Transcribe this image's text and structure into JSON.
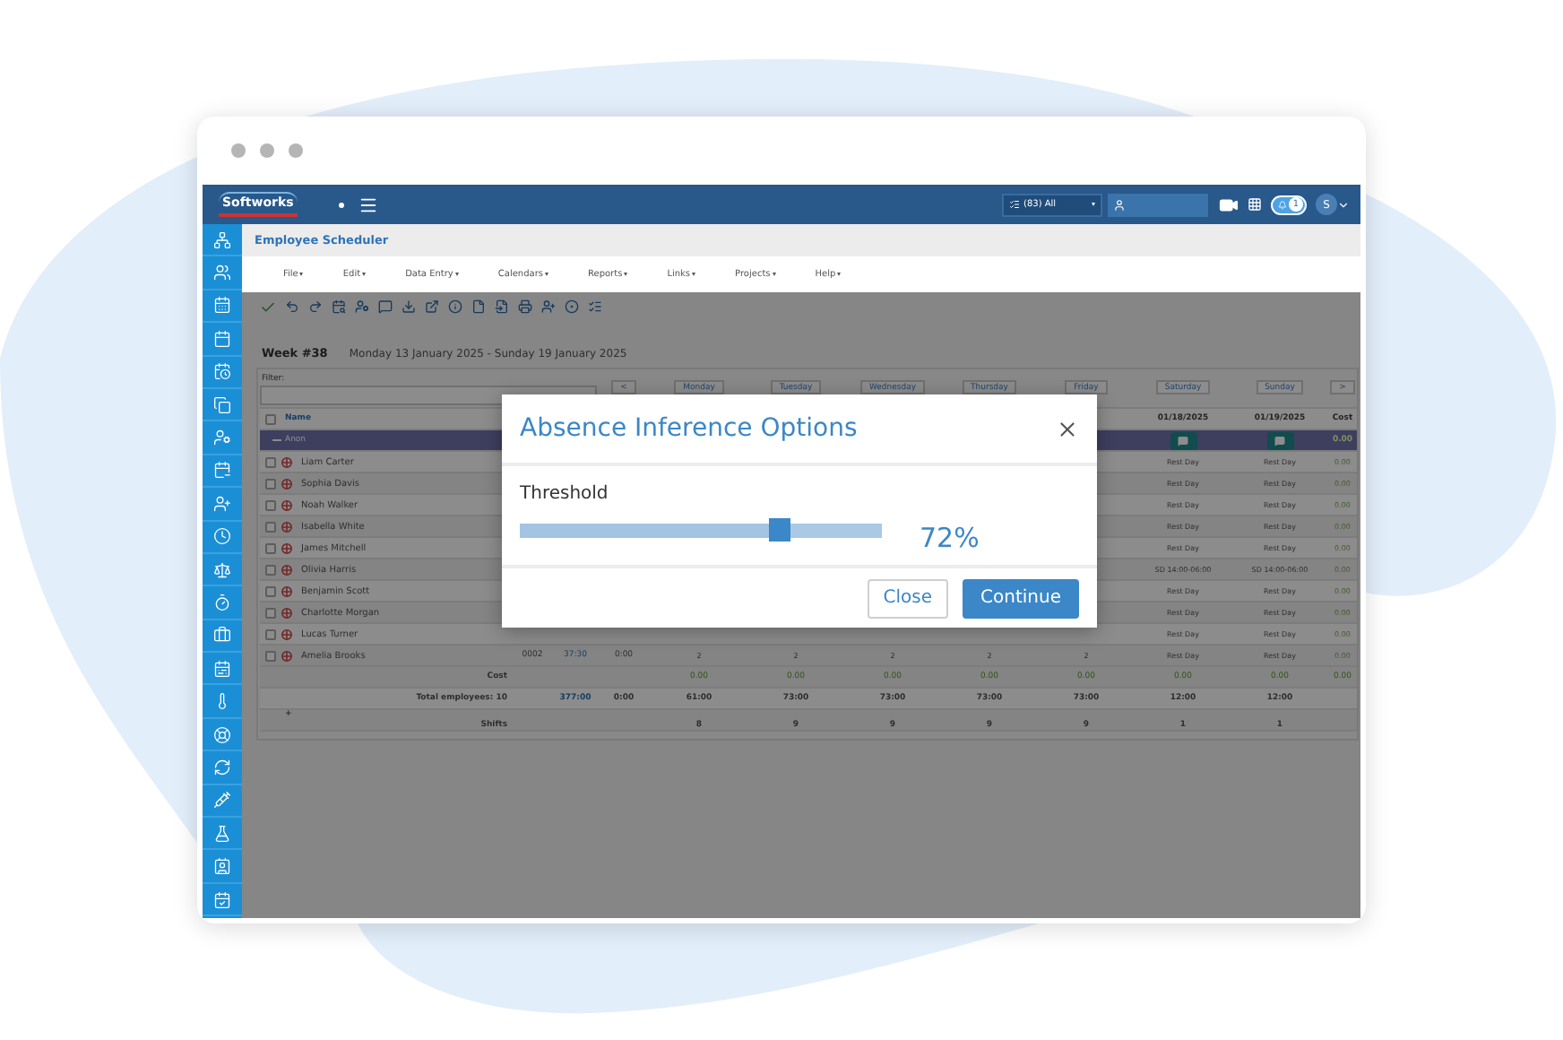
{
  "top_bar": {
    "logo": "Softworks",
    "dropdown": {
      "value": "(83) All"
    },
    "notification_count": "1",
    "avatar": "S"
  },
  "app_title": "Employee Scheduler",
  "menu": [
    "File",
    "Edit",
    "Data Entry",
    "Calendars",
    "Reports",
    "Links",
    "Projects",
    "Help"
  ],
  "week": {
    "number": "Week #38",
    "range": "Monday 13 January 2025 - Sunday 19 January 2025"
  },
  "filter": {
    "label": "Filter:"
  },
  "day_nav": {
    "prev": "<",
    "next": ">",
    "days": [
      "Monday",
      "Tuesday",
      "Wednesday",
      "Thursday",
      "Friday",
      "Saturday",
      "Sunday"
    ]
  },
  "table": {
    "header": {
      "checked": false,
      "name": "Name",
      "dates": [
        "01/18/2025",
        "01/19/2025"
      ],
      "cost": "Cost"
    },
    "group": {
      "label": "Anon",
      "expanded": true,
      "cells": [
        {
          "kind": "chat"
        },
        {
          "kind": "chat"
        }
      ],
      "cost": "0.00"
    },
    "rows": [
      {
        "name": "Liam Carter",
        "checked": false,
        "days": [
          "Rest Day",
          "Rest Day"
        ],
        "cost": "0.00"
      },
      {
        "name": "Sophia Davis",
        "checked": false,
        "days": [
          "Rest Day",
          "Rest Day"
        ],
        "cost": "0.00"
      },
      {
        "name": "Noah Walker",
        "checked": false,
        "days": [
          "Rest Day",
          "Rest Day"
        ],
        "cost": "0.00"
      },
      {
        "name": "Isabella White",
        "checked": false,
        "days": [
          "Rest Day",
          "Rest Day"
        ],
        "cost": "0.00"
      },
      {
        "name": "James Mitchell",
        "checked": false,
        "days": [
          "Rest Day",
          "Rest Day"
        ],
        "cost": "0.00"
      },
      {
        "name": "Olivia Harris",
        "checked": false,
        "days": [
          "SD 14:00-06:00",
          "SD 14:00-06:00"
        ],
        "cost": "0.00"
      },
      {
        "name": "Benjamin Scott",
        "checked": false,
        "days": [
          "Rest Day",
          "Rest Day"
        ],
        "cost": "0.00"
      },
      {
        "name": "Charlotte Morgan",
        "checked": false,
        "days": [
          "Rest Day",
          "Rest Day"
        ],
        "cost": "0.00"
      },
      {
        "name": "Lucas Turner",
        "checked": false,
        "days": [
          "Rest Day",
          "Rest Day"
        ],
        "cost": "0.00"
      },
      {
        "name": "Amelia Brooks",
        "checked": false,
        "column_3": "0002",
        "column_4": "37:30",
        "column_5": "0:00",
        "days": [
          "2",
          "2",
          "2",
          "2",
          "2",
          "Rest Day",
          "Rest Day"
        ],
        "cost": "0.00"
      }
    ],
    "cost_row": {
      "label": "Cost",
      "days": [
        "0.00",
        "0.00",
        "0.00",
        "0.00",
        "0.00",
        "0.00",
        "0.00"
      ],
      "cost": "0.00"
    },
    "total_row": {
      "label": "Total employees: 10",
      "column_4": "377:00",
      "column_5": "0:00",
      "days": [
        "61:00",
        "73:00",
        "73:00",
        "73:00",
        "73:00",
        "12:00",
        "12:00"
      ]
    },
    "shifts_row": {
      "toggle": "+",
      "label": "Shifts",
      "days": [
        "8",
        "9",
        "9",
        "9",
        "9",
        "1",
        "1"
      ]
    }
  },
  "modal": {
    "title": "Absence Inference Options",
    "slider": {
      "label": "Threshold",
      "level": 0.72,
      "reading": "72%"
    },
    "buttons": [
      {
        "label": "Close",
        "kind": "secondary"
      },
      {
        "label": "Continue",
        "kind": "primary"
      }
    ]
  }
}
